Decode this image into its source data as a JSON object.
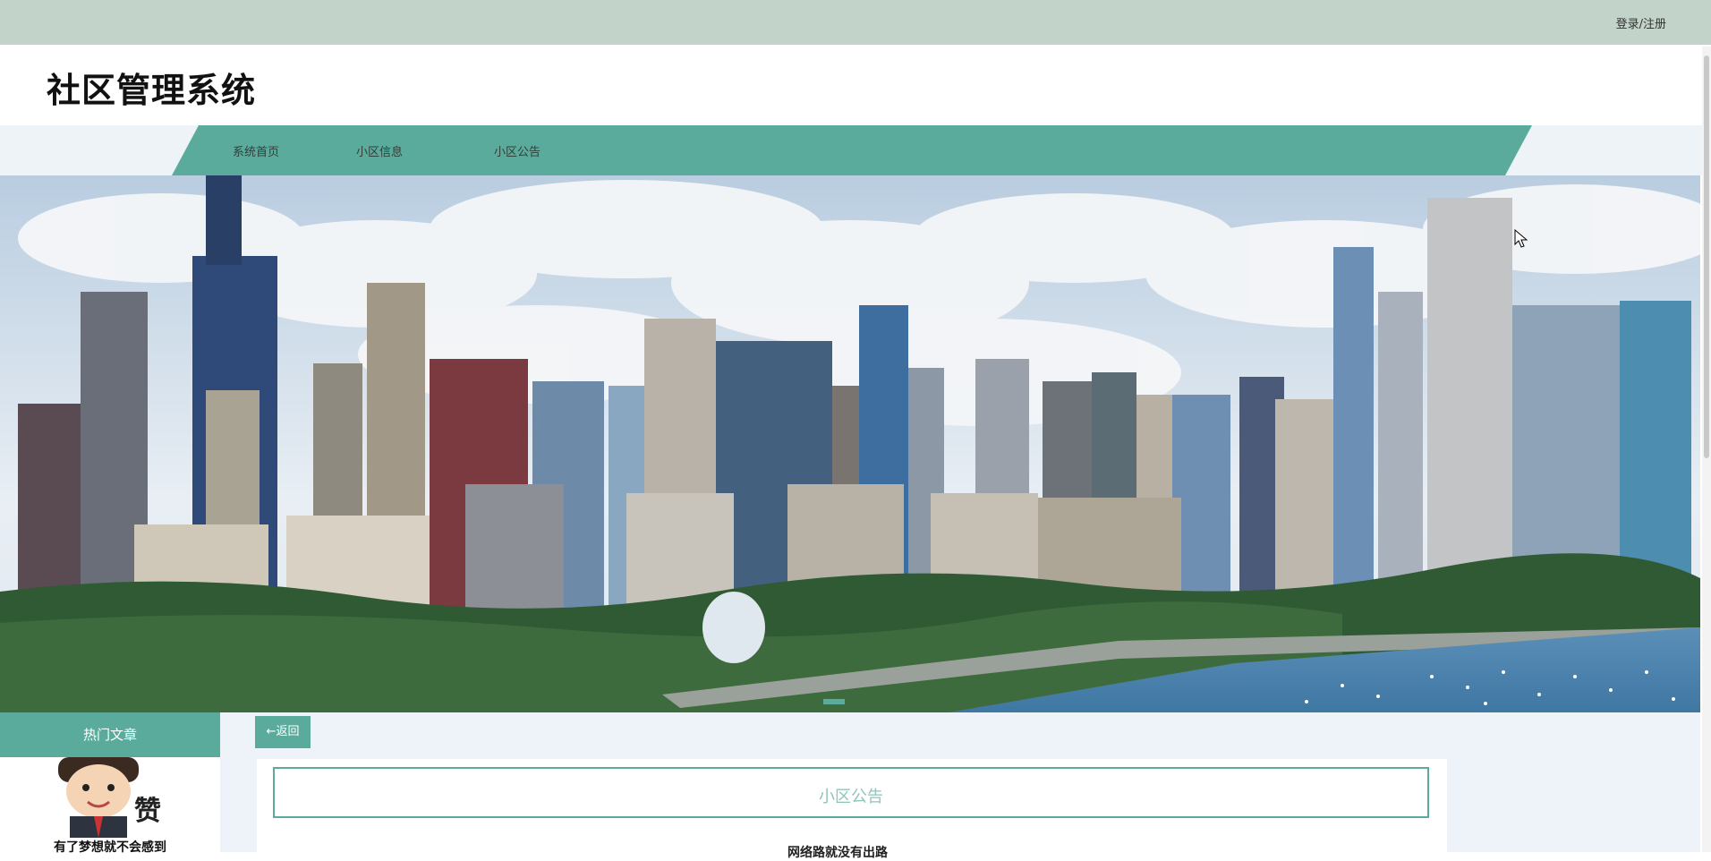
{
  "header": {
    "login_label": "登录/注册",
    "brand": "社区管理系统"
  },
  "nav": {
    "items": [
      {
        "label": "系统首页"
      },
      {
        "label": "小区信息"
      },
      {
        "label": "小区公告"
      }
    ]
  },
  "sidebar": {
    "title": "热门文章",
    "article_caption": "有了梦想就不会感到"
  },
  "main": {
    "back_label": "←返回",
    "section_title": "小区公告",
    "article_title": "网络路就没有出路"
  },
  "colors": {
    "accent": "#5bab9c",
    "topbar": "#c2d3c9"
  }
}
